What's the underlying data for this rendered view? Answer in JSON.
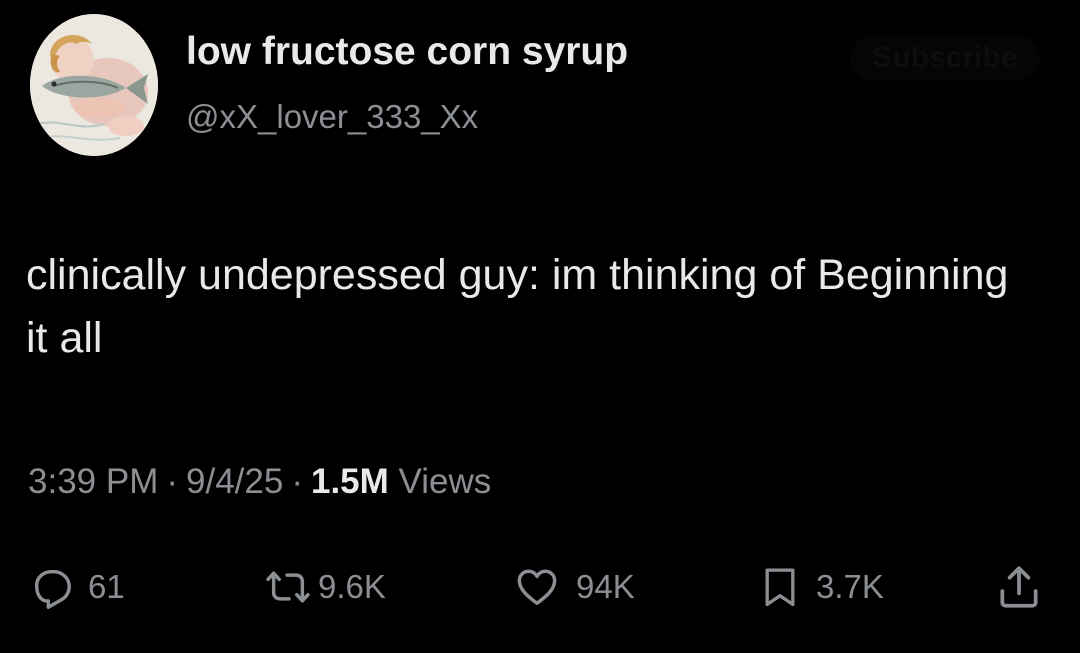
{
  "author": {
    "display_name": "low fructose corn syrup",
    "handle": "@xX_lover_333_Xx"
  },
  "header": {
    "top_right_button_label": "Subscribe"
  },
  "tweet": {
    "text": "clinically undepressed guy: im thinking of Beginning it all",
    "time": "3:39 PM",
    "date": "9/4/25",
    "separator": "·",
    "views_count": "1.5M",
    "views_label": "Views"
  },
  "actions": {
    "replies": "61",
    "reposts": "9.6K",
    "likes": "94K",
    "bookmarks": "3.7K"
  },
  "icons": {
    "reply": "reply-icon",
    "repost": "repost-icon",
    "like": "heart-icon",
    "bookmark": "bookmark-icon",
    "share": "share-icon"
  },
  "colors": {
    "background": "#000000",
    "primary_text": "#e7e9ea",
    "secondary_text": "#8b8f94"
  }
}
